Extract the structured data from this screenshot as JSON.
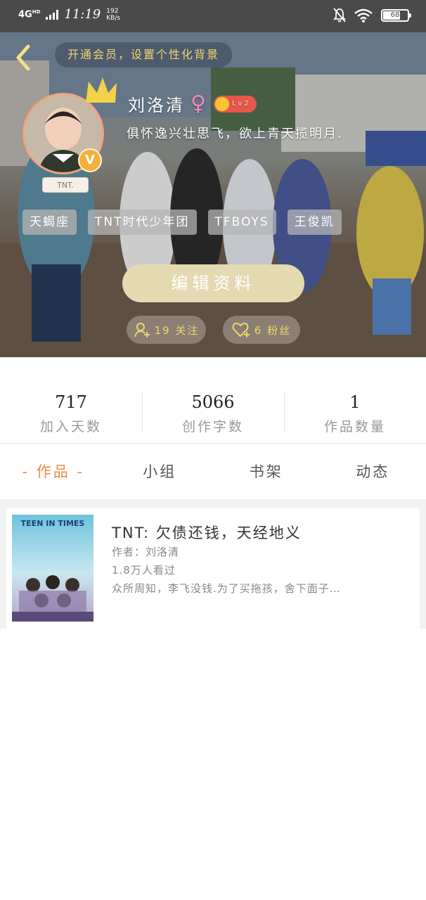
{
  "status_bar": {
    "network": "4G",
    "network_sup": "HD",
    "time": "11:19",
    "speed_value": "192",
    "speed_unit": "KB/s",
    "battery": "68"
  },
  "hero": {
    "vip_banner": "开通会员，设置个性化背景",
    "username": "刘洛清",
    "gender_symbol": "♀",
    "level": "Lv2",
    "signature": "俱怀逸兴壮思飞，欲上青天揽明月.",
    "avatar_tag": "TNT.",
    "verified_badge": "V",
    "tags": [
      "天蝎座",
      "TNT时代少年团",
      "TFBOYS",
      "王俊凯"
    ],
    "edit_button": "编辑资料",
    "following": "19 关注",
    "followers": "6 粉丝"
  },
  "stats": [
    {
      "value": "717",
      "label": "加入天数"
    },
    {
      "value": "5066",
      "label": "创作字数"
    },
    {
      "value": "1",
      "label": "作品数量"
    }
  ],
  "tabs": [
    "- 作品 -",
    "小组",
    "书架",
    "动态"
  ],
  "works": [
    {
      "cover_text": "TEEN IN TIMES",
      "title": "TNT:  欠债还钱，天经地义",
      "author": "作者：刘洛清",
      "views": "1.8万人看过",
      "description": "众所周知，李飞没钱.为了买拖孩，舍下面子…"
    }
  ],
  "colors": {
    "accent": "#ee8a46",
    "edit_button": "#e5d9b2",
    "vip_text": "#f0d76a",
    "status_bar": "#4a4a4a"
  }
}
